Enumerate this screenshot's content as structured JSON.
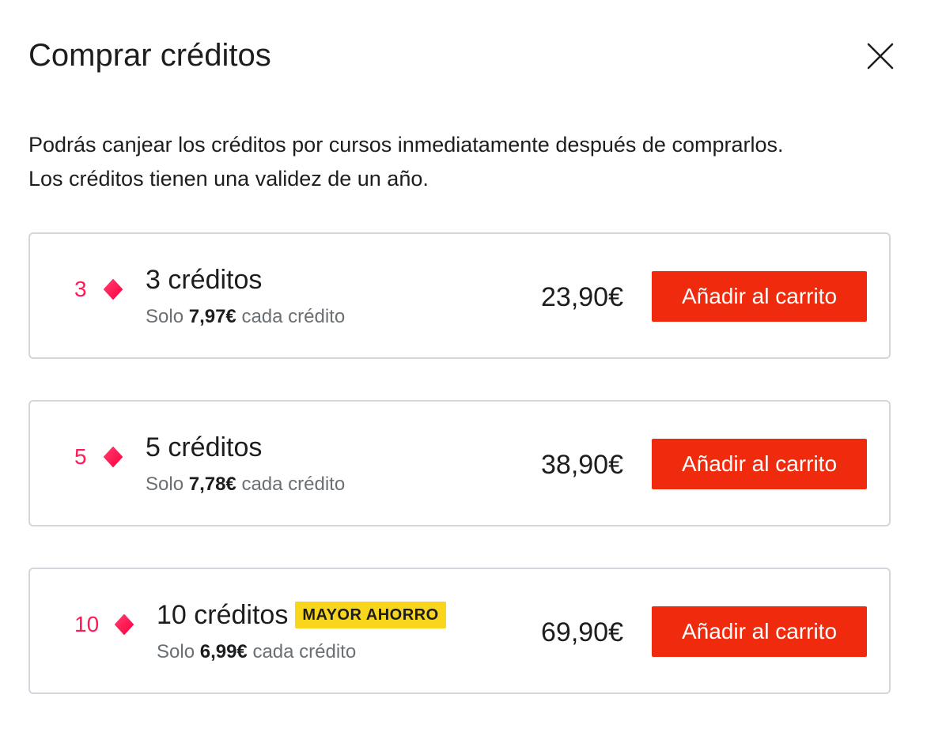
{
  "dialog": {
    "title": "Comprar créditos",
    "close_icon": "close-icon",
    "description": [
      "Podrás canjear los créditos por cursos inmediatamente después de comprarlos.",
      "Los créditos tienen una validez de un año."
    ]
  },
  "colors": {
    "accent_button": "#f02a0c",
    "credit_count": "#ff1a55",
    "badge": "#f9d51c"
  },
  "packages": [
    {
      "count": "3",
      "icon": "credit-diamond-icon",
      "name": "3 créditos",
      "sub_prefix": "Solo",
      "unit_price": "7,97€",
      "sub_suffix": "cada crédito",
      "price": "23,90€",
      "button_label": "Añadir al carrito"
    },
    {
      "count": "5",
      "icon": "credit-diamond-icon",
      "name": "5 créditos",
      "sub_prefix": "Solo",
      "unit_price": "7,78€",
      "sub_suffix": "cada crédito",
      "price": "38,90€",
      "button_label": "Añadir al carrito"
    },
    {
      "count": "10",
      "icon": "credit-diamond-icon",
      "name": "10 créditos",
      "badge": "MAYOR AHORRO",
      "sub_prefix": "Solo",
      "unit_price": "6,99€",
      "sub_suffix": "cada crédito",
      "price": "69,90€",
      "button_label": "Añadir al carrito"
    }
  ]
}
